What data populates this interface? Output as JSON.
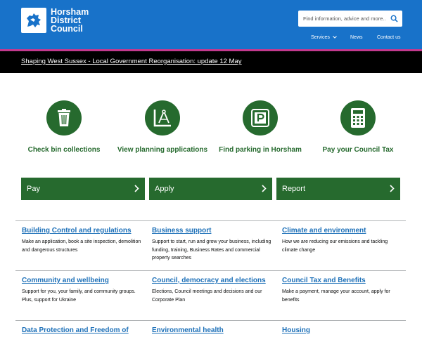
{
  "header": {
    "logo_lines": [
      "Horsham",
      "District",
      "Council"
    ],
    "search_placeholder": "Find information, advice and more...",
    "nav": {
      "services": "Services",
      "news": "News",
      "contact": "Contact us"
    }
  },
  "banner": {
    "text": "Shaping West Sussex - Local Government Reorganisation: update 12 May"
  },
  "quick_links": [
    {
      "label": "Check bin collections",
      "icon": "bin-icon"
    },
    {
      "label": "View planning applications",
      "icon": "planning-compass-icon"
    },
    {
      "label": "Find parking in Horsham",
      "icon": "parking-icon"
    },
    {
      "label": "Pay your Council Tax",
      "icon": "calculator-icon"
    }
  ],
  "actions": [
    {
      "label": "Pay"
    },
    {
      "label": "Apply"
    },
    {
      "label": "Report"
    }
  ],
  "services": [
    {
      "title": "Building Control and regulations",
      "desc": "Make an application, book a site inspection, demolition and dangerous structures"
    },
    {
      "title": "Business support",
      "desc": "Support to start, run and grow your business, including funding, training, Business Rates and commercial property searches"
    },
    {
      "title": "Climate and environment",
      "desc": "How we are reducing our emissions and tackling climate change"
    },
    {
      "title": "Community and wellbeing",
      "desc": "Support for you, your family, and community groups. Plus, support for Ukraine"
    },
    {
      "title": "Council, democracy and elections",
      "desc": "Elections, Council meetings and decisions and our Corporate Plan"
    },
    {
      "title": "Council Tax and Benefits",
      "desc": "Make a payment, manage your account, apply for benefits"
    },
    {
      "title": "Data Protection and Freedom of",
      "desc": ""
    },
    {
      "title": "Environmental health",
      "desc": ""
    },
    {
      "title": "Housing",
      "desc": ""
    }
  ],
  "colors": {
    "header_blue": "#1872c9",
    "green": "#266a2e",
    "link_blue": "#1d70b8",
    "stripe_pink": "#c23a8e"
  }
}
